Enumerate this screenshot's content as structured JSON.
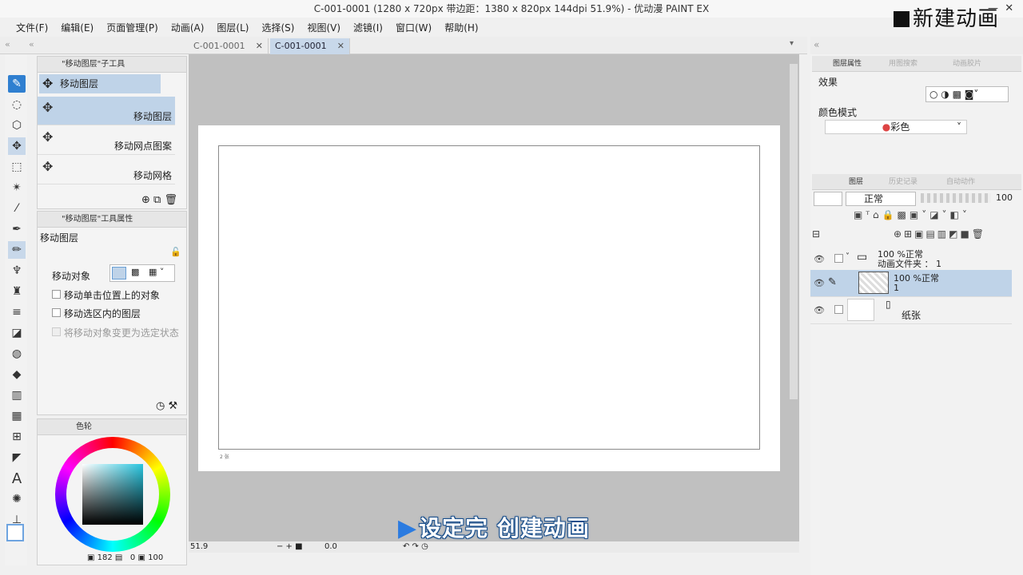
{
  "title": "C-001-0001 (1280 x 720px 带边距：1380 x 820px 144dpi 51.9%)  - 优动漫 PAINT EX",
  "overlay_title": "新建动画",
  "menu": [
    "文件(F)",
    "编辑(E)",
    "页面管理(P)",
    "动画(A)",
    "图层(L)",
    "选择(S)",
    "视图(V)",
    "滤镜(I)",
    "窗口(W)",
    "帮助(H)"
  ],
  "tabs": [
    {
      "label": "C-001-0001"
    },
    {
      "label": "C-001-0001"
    }
  ],
  "subtool_panel": {
    "title": "\"移动图层\"子工具",
    "current": "移动图层",
    "items": [
      "移动图层",
      "移动网点图案",
      "移动网格"
    ]
  },
  "tool_property": {
    "title": "\"移动图层\"工具属性",
    "name": "移动图层",
    "move_target_label": "移动对象",
    "options": [
      "移动单击位置上的对象",
      "移动选区内的图层",
      "将移动对象变更为选定状态"
    ]
  },
  "color_panel": {
    "title": "色轮",
    "values": "182",
    "extra": "0",
    "opacity": "100"
  },
  "layer_property": {
    "tabs": [
      "图层属性",
      "用图搜索",
      "动画胶片"
    ],
    "effect_label": "效果",
    "color_mode_label": "颜色模式",
    "color_mode_value": "彩色"
  },
  "layers_panel": {
    "tabs": [
      "图层",
      "历史记录",
      "自动动作"
    ],
    "blend_mode": "正常",
    "opacity": "100",
    "layers": [
      {
        "line1": "100 %正常",
        "line2": "动画文件夹 ： 1"
      },
      {
        "line1": "100 %正常",
        "line2": "1"
      },
      {
        "line1": "",
        "line2": "纸张"
      }
    ]
  },
  "canvas": {
    "frame_label": "2 张"
  },
  "status": {
    "zoom": "51.9",
    "angle": "0.0"
  },
  "caption": "设定完 创建动画"
}
